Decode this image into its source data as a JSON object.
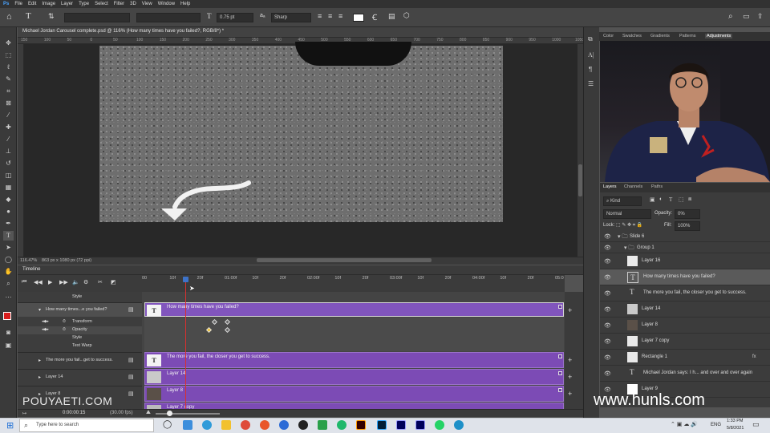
{
  "menu": [
    "File",
    "Edit",
    "Image",
    "Layer",
    "Type",
    "Select",
    "Filter",
    "3D",
    "View",
    "Window",
    "Help"
  ],
  "options": {
    "font_size": "0.75 pt",
    "antialias": "Sharp"
  },
  "document_tab": "Michael Jordan Carousel complete.psd @ 116% (How many times have you failed?, RGB/8*) *",
  "ruler_ticks": [
    "150",
    "100",
    "50",
    "0",
    "50",
    "100",
    "150",
    "200",
    "250",
    "300",
    "350",
    "400",
    "450",
    "500",
    "550",
    "600",
    "650",
    "700",
    "750",
    "800",
    "850",
    "900",
    "950",
    "1000",
    "1050"
  ],
  "status": {
    "zoom": "116.47%",
    "doc_size": "863 px x 1080 px (72 ppi)"
  },
  "timeline": {
    "title": "Timeline",
    "ticks": [
      "00",
      "10f",
      "20f",
      "01:00f",
      "10f",
      "20f",
      "02:00f",
      "10f",
      "20f",
      "03:00f",
      "10f",
      "20f",
      "04:00f",
      "10f",
      "20f",
      "05:0"
    ],
    "timecode": "0:00:00:15",
    "fps": "(30.00 fps)",
    "left_rows": [
      "Style",
      "How many times...e you failed?",
      "Transform",
      "Opacity",
      "Style",
      "Text Warp",
      "The more you fail...get to success.",
      "Layer 14",
      "Layer 8"
    ],
    "clips": [
      {
        "label": "How many times have you failed?",
        "thumb": "T"
      },
      {
        "label": "The more you fail, the closer you get to success.",
        "thumb": "T"
      },
      {
        "label": "Layer 14",
        "thumb": ""
      },
      {
        "label": "Layer 8",
        "thumb": ""
      },
      {
        "label": "Layer 7 copy",
        "thumb": ""
      }
    ]
  },
  "right_panel_tabs": [
    "Color",
    "Swatches",
    "Gradients",
    "Patterns",
    "Adjustments"
  ],
  "layers_panel": {
    "tabs": [
      "Layers",
      "Channels",
      "Paths"
    ],
    "kind": "Kind",
    "blend": "Normal",
    "opacity_label": "Opacity:",
    "opacity": "0%",
    "lock_label": "Lock:",
    "fill_label": "Fill:",
    "fill": "100%",
    "layers": [
      {
        "name": "Slide 6",
        "type": "group"
      },
      {
        "name": "Group 1",
        "type": "group"
      },
      {
        "name": "Layer 16",
        "type": "pixel"
      },
      {
        "name": "How many times have you failed?",
        "type": "text"
      },
      {
        "name": "The more you fail, the closer you get to success.",
        "type": "text"
      },
      {
        "name": "Layer 14",
        "type": "pixel"
      },
      {
        "name": "Layer 8",
        "type": "pixel"
      },
      {
        "name": "Layer 7 copy",
        "type": "pixel"
      },
      {
        "name": "Rectangle 1",
        "type": "pixel"
      },
      {
        "name": "Michael Jordan says: I h... and over and over again",
        "type": "text"
      },
      {
        "name": "Layer 9",
        "type": "pixel"
      }
    ]
  },
  "watermark_left": "POUYAETI.COM",
  "watermark_right": "www.hunls.com",
  "taskbar": {
    "search": "Type here to search",
    "time": "1:33 PM",
    "date": "5/8/2021",
    "lang": "ENG"
  }
}
